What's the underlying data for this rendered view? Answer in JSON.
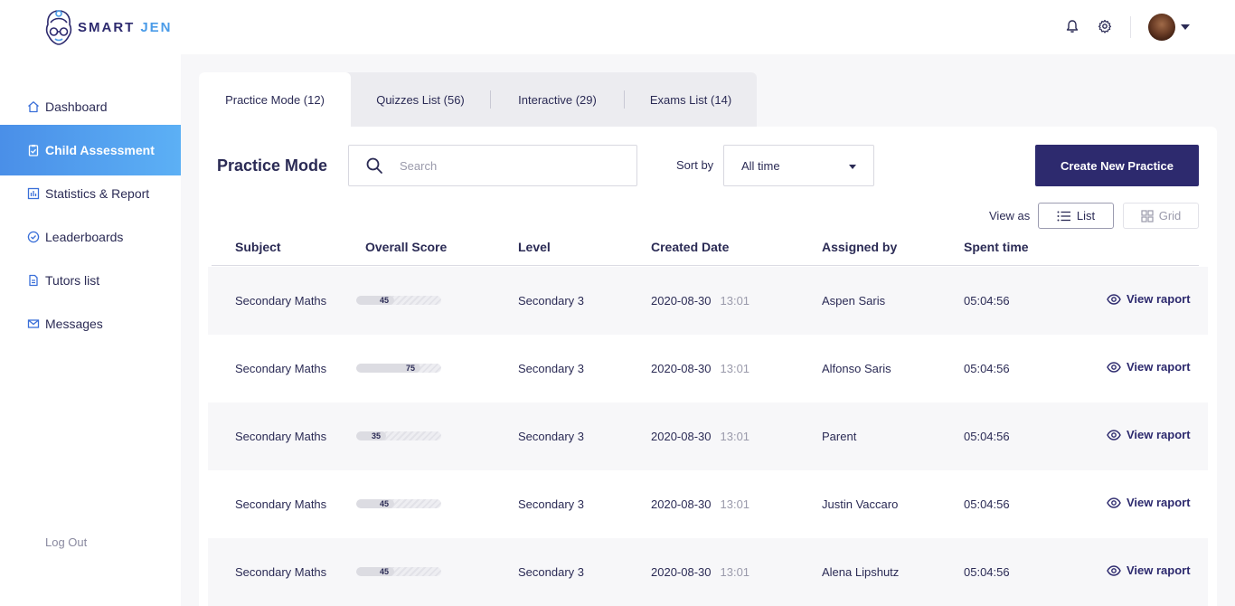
{
  "brand": {
    "part1": "SMART",
    "part2": "JEN"
  },
  "sidebar": {
    "items": [
      {
        "label": "Dashboard",
        "icon": "home-icon",
        "active": false
      },
      {
        "label": "Child Assessment",
        "icon": "clipboard-icon",
        "active": true
      },
      {
        "label": "Statistics & Report",
        "icon": "chart-icon",
        "active": false
      },
      {
        "label": "Leaderboards",
        "icon": "badge-check-icon",
        "active": false
      },
      {
        "label": "Tutors list",
        "icon": "document-icon",
        "active": false
      },
      {
        "label": "Messages",
        "icon": "mail-icon",
        "active": false
      }
    ],
    "logout": "Log Out"
  },
  "tabs": [
    {
      "label": "Practice Mode (12)",
      "active": true
    },
    {
      "label": "Quizzes List (56)",
      "active": false
    },
    {
      "label": "Interactive (29)",
      "active": false
    },
    {
      "label": "Exams List (14)",
      "active": false
    }
  ],
  "main": {
    "title": "Practice Mode",
    "search_placeholder": "Search",
    "sort_label": "Sort by",
    "sort_value": "All time",
    "create_button": "Create New Practice",
    "view_as_label": "View as",
    "view_list": "List",
    "view_grid": "Grid"
  },
  "table": {
    "headers": [
      "Subject",
      "Overall Score",
      "Level",
      "Created Date",
      "Assigned by",
      "Spent time"
    ],
    "action_label": "View raport",
    "rows": [
      {
        "subject": "Secondary Maths",
        "score": 45,
        "level": "Secondary 3",
        "date": "2020-08-30",
        "time": "13:01",
        "assigned_by": "Aspen Saris",
        "spent": "05:04:56"
      },
      {
        "subject": "Secondary Maths",
        "score": 75,
        "level": "Secondary 3",
        "date": "2020-08-30",
        "time": "13:01",
        "assigned_by": "Alfonso Saris",
        "spent": "05:04:56"
      },
      {
        "subject": "Secondary Maths",
        "score": 35,
        "level": "Secondary 3",
        "date": "2020-08-30",
        "time": "13:01",
        "assigned_by": "Parent",
        "spent": "05:04:56"
      },
      {
        "subject": "Secondary Maths",
        "score": 45,
        "level": "Secondary 3",
        "date": "2020-08-30",
        "time": "13:01",
        "assigned_by": "Justin Vaccaro",
        "spent": "05:04:56"
      },
      {
        "subject": "Secondary Maths",
        "score": 45,
        "level": "Secondary 3",
        "date": "2020-08-30",
        "time": "13:01",
        "assigned_by": "Alena Lipshutz",
        "spent": "05:04:56"
      }
    ]
  },
  "colors": {
    "brand_dark": "#2d2a6e",
    "brand_blue": "#4a9be8",
    "active_nav": "#4a8fe8"
  }
}
